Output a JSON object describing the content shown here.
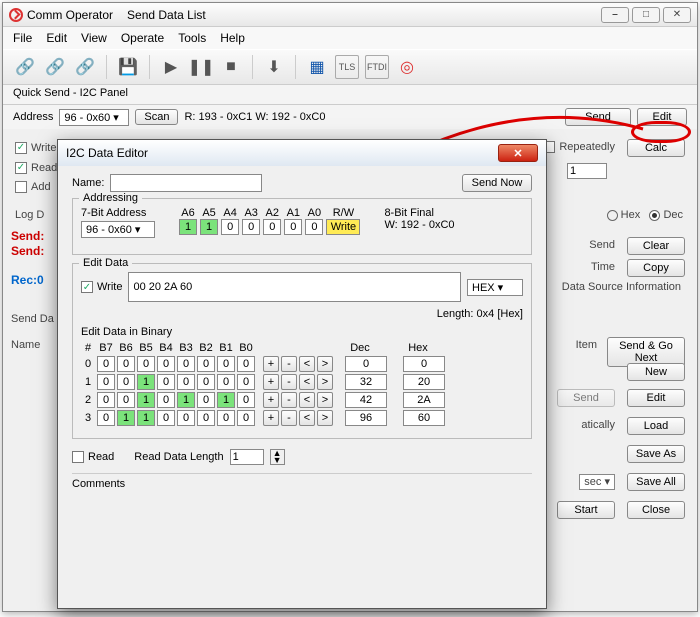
{
  "window": {
    "title1": "Comm Operator",
    "title2": "Send Data List",
    "min": "⎯",
    "max": "□",
    "close": "✕"
  },
  "menu": [
    "File",
    "Edit",
    "View",
    "Operate",
    "Tools",
    "Help"
  ],
  "panel_label": "Quick Send - I2C Panel",
  "addressbar": {
    "label": "Address",
    "value": "96 - 0x60",
    "scan": "Scan",
    "status": "R: 193 - 0xC1 W: 192 - 0xC0",
    "send": "Send",
    "edit": "Edit"
  },
  "bgrows": {
    "write": "Write",
    "read": "Read",
    "add": "Add",
    "repeat": "Repeatedly",
    "calc": "Calc",
    "one": "1",
    "logd": "Log D",
    "send1": "Send:",
    "send2": "Send:",
    "rec": "Rec:0",
    "hex": "Hex",
    "dec": "Dec",
    "send3": "Send",
    "clear": "Clear",
    "time": "Time",
    "copy": "Copy",
    "dsinfo": "Data Source Information",
    "senddata": "Send Da",
    "name": "Name",
    "item": "Item",
    "sendgo": "Send & Go Next",
    "new": "New",
    "edit2": "Edit",
    "send4": "Send",
    "atically": "atically",
    "load": "Load",
    "saveas": "Save As",
    "sec": "sec",
    "saveall": "Save All",
    "start": "Start",
    "close2": "Close"
  },
  "dialog": {
    "title": "I2C Data Editor",
    "name_label": "Name:",
    "sendnow": "Send Now",
    "addressing": {
      "title": "Addressing",
      "bit7": "7-Bit Address",
      "value": "96 - 0x60",
      "cols": [
        "A6",
        "A5",
        "A4",
        "A3",
        "A2",
        "A1",
        "A0",
        "R/W"
      ],
      "bits": [
        "1",
        "1",
        "0",
        "0",
        "0",
        "0",
        "0"
      ],
      "rw": "Write",
      "final_label": "8-Bit Final",
      "final_value": "W: 192 - 0xC0"
    },
    "editdata": {
      "title": "Edit Data",
      "write": "Write",
      "value": "00 20 2A 60",
      "format": "HEX",
      "length": "Length: 0x4 [Hex]"
    },
    "binary": {
      "title": "Edit Data in Binary",
      "head_hash": "#",
      "head_bits": [
        "B7",
        "B6",
        "B5",
        "B4",
        "B3",
        "B2",
        "B1",
        "B0"
      ],
      "head_dec": "Dec",
      "head_hex": "Hex",
      "ops": [
        "+",
        "-",
        "<",
        ">"
      ],
      "rows": [
        {
          "n": "0",
          "bits": [
            "0",
            "0",
            "0",
            "0",
            "0",
            "0",
            "0",
            "0"
          ],
          "dec": "0",
          "hex": "0"
        },
        {
          "n": "1",
          "bits": [
            "0",
            "0",
            "1",
            "0",
            "0",
            "0",
            "0",
            "0"
          ],
          "dec": "32",
          "hex": "20"
        },
        {
          "n": "2",
          "bits": [
            "0",
            "0",
            "1",
            "0",
            "1",
            "0",
            "1",
            "0"
          ],
          "dec": "42",
          "hex": "2A"
        },
        {
          "n": "3",
          "bits": [
            "0",
            "1",
            "1",
            "0",
            "0",
            "0",
            "0",
            "0"
          ],
          "dec": "96",
          "hex": "60"
        }
      ]
    },
    "read_label": "Read",
    "readlen_label": "Read Data Length",
    "readlen_value": "1",
    "comments": "Comments"
  }
}
